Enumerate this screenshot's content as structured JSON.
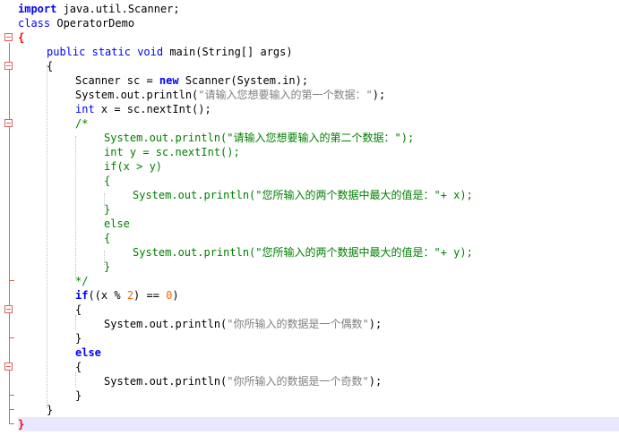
{
  "editor": {
    "lines": {
      "l1": {
        "kw": "import",
        "rest": " java.util.Scanner;"
      },
      "l2": {
        "kw": "class",
        "rest": " OperatorDemo"
      },
      "l3": {
        "text": "{"
      },
      "l4": {
        "kw1": "public",
        "kw2": "static",
        "kw3": "void",
        "rest": " main(String[] args)"
      },
      "l5": {
        "text": "{"
      },
      "l6": {
        "a": "Scanner sc = ",
        "kw": "new",
        "b": " Scanner(System.in);"
      },
      "l7": {
        "a": "System.out.println(",
        "str": "\"请输入您想要输入的第一个数据：\"",
        "b": ");"
      },
      "l8": {
        "kw": "int",
        "rest": " x = sc.nextInt();"
      },
      "l9": {
        "text": "/*"
      },
      "l10": {
        "text": "System.out.println(\"请输入您想要输入的第二个数据：\");"
      },
      "l11": {
        "text": "int y = sc.nextInt();"
      },
      "l12": {
        "text": "if(x > y)"
      },
      "l13": {
        "text": "{"
      },
      "l14": {
        "text": "System.out.println(\"您所输入的两个数据中最大的值是：\"+ x);"
      },
      "l15": {
        "text": "}"
      },
      "l16": {
        "text": "else"
      },
      "l17": {
        "text": "{"
      },
      "l18": {
        "text": "System.out.println(\"您所输入的两个数据中最大的值是：\"+ y);"
      },
      "l19": {
        "text": "}"
      },
      "l20": {
        "text": "*/"
      },
      "l21": {
        "kw": "if",
        "a": "((x % ",
        "n1": "2",
        "b": ") == ",
        "n2": "0",
        "c": ")"
      },
      "l22": {
        "text": "{"
      },
      "l23": {
        "a": "System.out.println(",
        "str": "\"你所输入的数据是一个偶数\"",
        "b": ");"
      },
      "l24": {
        "text": "}"
      },
      "l25": {
        "kw": "else"
      },
      "l26": {
        "text": "{"
      },
      "l27": {
        "a": "System.out.println(",
        "str": "\"你所输入的数据是一个奇数\"",
        "b": ");"
      },
      "l28": {
        "text": "}"
      },
      "l29": {
        "text": "}"
      },
      "l30": {
        "text": "}"
      }
    },
    "colors": {
      "keyword": "#0000ff",
      "string": "#808080",
      "number": "#ff6600",
      "comment": "#008000",
      "fold_marker": "#e06060",
      "current_line": "#e8e8ff"
    }
  }
}
